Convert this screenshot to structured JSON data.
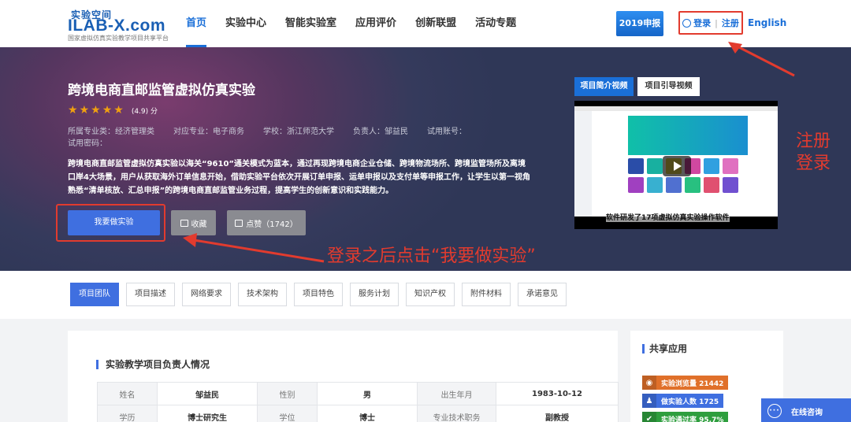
{
  "header": {
    "logo_cn": "实验空间",
    "logo_main": "ILAB-X.com",
    "logo_sub": "国家虚拟仿真实验教学项目共享平台",
    "nav": [
      "首页",
      "实验中心",
      "智能实验室",
      "应用评价",
      "创新联盟",
      "活动专题"
    ],
    "badge": "2019申报",
    "login": "登录",
    "register": "注册",
    "lang": "English"
  },
  "hero": {
    "title": "跨境电商直邮监管虚拟仿真实验",
    "rating": 4.9,
    "score": "(4.9) 分",
    "meta": [
      "所属专业类：经济管理类",
      "对应专业：电子商务",
      "学校：浙江师范大学",
      "负责人：邹益民",
      "试用账号："
    ],
    "meta2": "试用密码：",
    "description": "跨境电商直邮监管虚拟仿真实验以海关“9610”通关模式为蓝本，通过再现跨境电商企业仓储、跨境物流场所、跨境监管场所及离境口岸4大场景，用户从获取海外订单信息开始，借助实验平台依次开展订单申报、运单申报以及支付单等申报工作，让学生以第一视角熟悉“清单核放、汇总申报”的跨境电商直邮监管业务过程，提高学生的创新意识和实践能力。",
    "do_button": "我要做实验",
    "fav_button": "收藏",
    "like_button": "点赞（1742）",
    "video_tab1": "项目简介视频",
    "video_tab2": "项目引导视频",
    "video_caption": "软件研发了17项虚拟仿真实验操作软件"
  },
  "annotations": {
    "register_login": "注册 登录",
    "after_login": "登录之后点击“我要做实验”"
  },
  "tabs": [
    "项目团队",
    "项目描述",
    "网络要求",
    "技术架构",
    "项目特色",
    "服务计划",
    "知识产权",
    "附件材料",
    "承诺意见"
  ],
  "content": {
    "section_title": "实验教学项目负责人情况",
    "rows": [
      [
        "姓名",
        "邹益民",
        "性别",
        "男",
        "出生年月",
        "1983-10-12"
      ],
      [
        "学历",
        "博士研究生",
        "学位",
        "博士",
        "专业技术职务",
        "副教授"
      ]
    ]
  },
  "side": {
    "title": "共享应用",
    "stats": [
      {
        "label": "实验浏览量 21442",
        "color": "#e0702a"
      },
      {
        "label": "做实验人数 1725",
        "color": "#3f6fe0"
      },
      {
        "label": "实验通过率 95.7%",
        "color": "#2e9e3e"
      }
    ]
  },
  "chat": {
    "label": "在线咨询"
  }
}
